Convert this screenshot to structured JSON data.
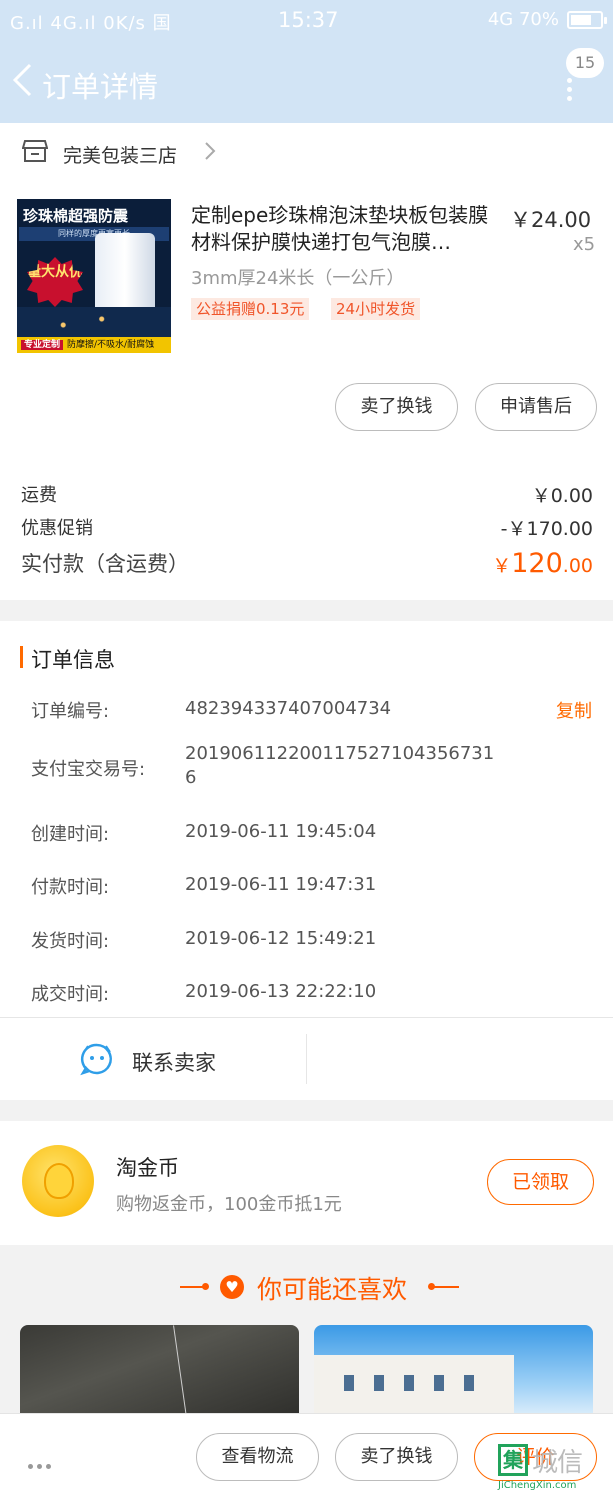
{
  "status_bar": {
    "left": "G.ıl 4G.ıl 0K/s 国",
    "time": "15:37",
    "right": "4G 70%",
    "battery_level": 0.7
  },
  "header": {
    "title": "订单详情",
    "badge": "15"
  },
  "shop": {
    "name": "完美包装三店"
  },
  "product": {
    "image_text": {
      "headline": "珍珠棉超强防震",
      "subline": "同样的厚度更宽更长",
      "burst": "量大从优",
      "bottom_tag": "专业定制",
      "bottom_text": "防摩擦/不吸水/耐腐蚀"
    },
    "title": "定制epe珍珠棉泡沫垫块板包装膜材料保护膜快递打包气泡膜…",
    "price": "￥24.00",
    "qty": "x5",
    "sku": "3mm厚24米长（一公斤）",
    "tags": [
      "公益捐赠0.13元",
      "24小时发货"
    ]
  },
  "item_actions": {
    "sell": "卖了换钱",
    "aftersale": "申请售后"
  },
  "fees": {
    "shipping_label": "运费",
    "shipping_val": "￥0.00",
    "promo_label": "优惠促销",
    "promo_val": "-￥170.00",
    "paid_label": "实付款（含运费）",
    "paid_currency": "￥",
    "paid_int": "120",
    "paid_dec": ".00"
  },
  "order_info": {
    "title": "订单信息",
    "copy_label": "复制",
    "rows": [
      {
        "label": "订单编号:",
        "value": "482394337407004734"
      },
      {
        "label": "支付宝交易号:",
        "value": "2019061122001175271043567316"
      },
      {
        "label": "创建时间:",
        "value": "2019-06-11 19:45:04"
      },
      {
        "label": "付款时间:",
        "value": "2019-06-11 19:47:31"
      },
      {
        "label": "发货时间:",
        "value": "2019-06-12 15:49:21"
      },
      {
        "label": "成交时间:",
        "value": "2019-06-13 22:22:10"
      }
    ]
  },
  "contact": {
    "label": "联系卖家"
  },
  "coin": {
    "title": "淘金币",
    "subtitle": "购物返金币，100金币抵1元",
    "button": "已领取"
  },
  "recommend": {
    "title": "你可能还喜欢"
  },
  "bottom_bar": {
    "logistics": "查看物流",
    "sell": "卖了换钱",
    "review": "评价"
  },
  "watermark": {
    "cn": "城信",
    "en": "JiChengXin.com",
    "box": "集"
  },
  "colors": {
    "accent": "#ff5a00",
    "header_bg": "#d2e4f5",
    "tag_bg": "#fde9e1"
  }
}
